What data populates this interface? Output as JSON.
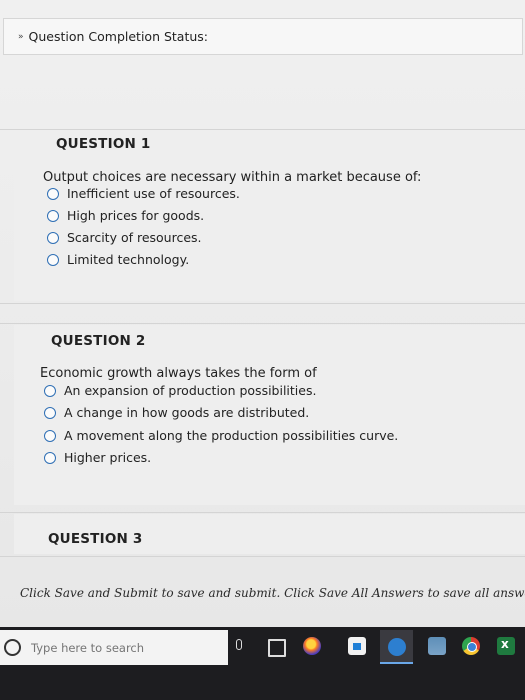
{
  "status": {
    "chevron": "»",
    "label": "Question Completion Status:"
  },
  "questions": [
    {
      "title": "QUESTION 1",
      "text": "Output choices are necessary within a market because of:",
      "options": [
        "Inefficient use of resources.",
        "High prices for goods.",
        "Scarcity of resources.",
        "Limited technology."
      ]
    },
    {
      "title": "QUESTION 2",
      "text": "Economic growth always takes the form of",
      "options": [
        "An expansion of production possibilities.",
        "A change in how goods are distributed.",
        "A movement along the production possibilities curve.",
        "Higher prices."
      ]
    },
    {
      "title": "QUESTION 3"
    }
  ],
  "footer": {
    "note": "Click Save and Submit to save and submit. Click Save All Answers to save all answers."
  },
  "taskbar": {
    "search_placeholder": "Type here to search",
    "icons": [
      "search-icon",
      "microphone-icon",
      "task-view-icon",
      "firefox-icon",
      "store-icon",
      "active-app-icon",
      "mail-icon",
      "chrome-icon",
      "excel-icon"
    ]
  }
}
